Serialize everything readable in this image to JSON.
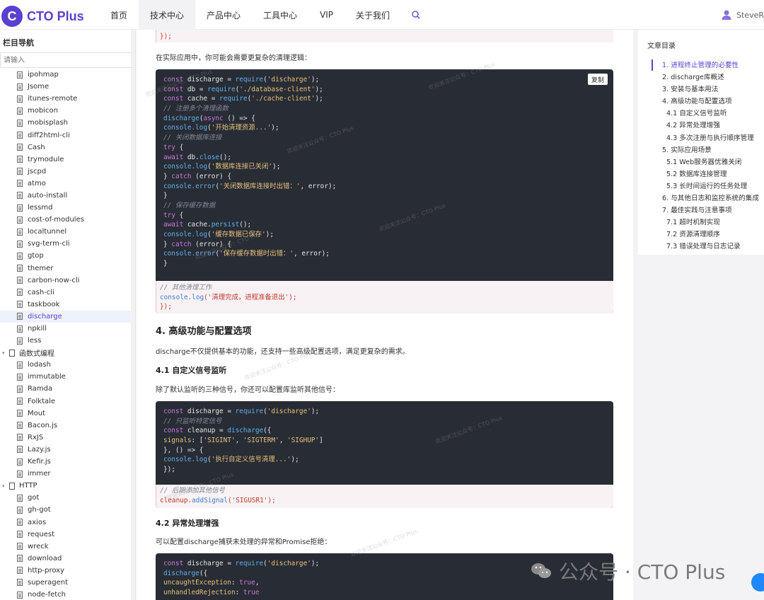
{
  "brand": {
    "logo_letter": "C",
    "name": "CTO Plus",
    "color": "#5b3fd0"
  },
  "nav": [
    {
      "label": "首页",
      "active": false
    },
    {
      "label": "技术中心",
      "active": true
    },
    {
      "label": "产品中心",
      "active": false
    },
    {
      "label": "工具中心",
      "active": false
    },
    {
      "label": "VIP",
      "active": false
    },
    {
      "label": "关于我们",
      "active": false
    }
  ],
  "user": {
    "name": "SteveR"
  },
  "sidebar": {
    "title": "栏目导航",
    "search_placeholder": "请输入",
    "items": [
      {
        "label": "ipohmap",
        "type": "child"
      },
      {
        "label": "Jsome",
        "type": "child"
      },
      {
        "label": "itunes-remote",
        "type": "child"
      },
      {
        "label": "mobicon",
        "type": "child"
      },
      {
        "label": "mobisplash",
        "type": "child"
      },
      {
        "label": "diff2html-cli",
        "type": "child"
      },
      {
        "label": "Cash",
        "type": "child"
      },
      {
        "label": "trymodule",
        "type": "child"
      },
      {
        "label": "jscpd",
        "type": "child"
      },
      {
        "label": "atmo",
        "type": "child"
      },
      {
        "label": "auto-install",
        "type": "child"
      },
      {
        "label": "lessmd",
        "type": "child"
      },
      {
        "label": "cost-of-modules",
        "type": "child"
      },
      {
        "label": "localtunnel",
        "type": "child"
      },
      {
        "label": "svg-term-cli",
        "type": "child"
      },
      {
        "label": "gtop",
        "type": "child"
      },
      {
        "label": "themer",
        "type": "child"
      },
      {
        "label": "carbon-now-cli",
        "type": "child"
      },
      {
        "label": "cash-cli",
        "type": "child"
      },
      {
        "label": "taskbook",
        "type": "child"
      },
      {
        "label": "discharge",
        "type": "child",
        "active": true
      },
      {
        "label": "npkill",
        "type": "child"
      },
      {
        "label": "less",
        "type": "child"
      },
      {
        "label": "函数式编程",
        "type": "group"
      },
      {
        "label": "lodash",
        "type": "child"
      },
      {
        "label": "immutable",
        "type": "child"
      },
      {
        "label": "Ramda",
        "type": "child"
      },
      {
        "label": "Folktale",
        "type": "child"
      },
      {
        "label": "Mout",
        "type": "child"
      },
      {
        "label": "Bacon.js",
        "type": "child"
      },
      {
        "label": "RxJS",
        "type": "child"
      },
      {
        "label": "Lazy.js",
        "type": "child"
      },
      {
        "label": "Kefir.js",
        "type": "child"
      },
      {
        "label": "immer",
        "type": "child"
      },
      {
        "label": "HTTP",
        "type": "group"
      },
      {
        "label": "got",
        "type": "child"
      },
      {
        "label": "gh-got",
        "type": "child"
      },
      {
        "label": "axios",
        "type": "child"
      },
      {
        "label": "request",
        "type": "child"
      },
      {
        "label": "wreck",
        "type": "child"
      },
      {
        "label": "download",
        "type": "child"
      },
      {
        "label": "http-proxy",
        "type": "child"
      },
      {
        "label": "superagent",
        "type": "child"
      },
      {
        "label": "node-fetch",
        "type": "child"
      }
    ]
  },
  "article": {
    "top_fragment": "});",
    "para_cleanup": "在实际应用中，你可能会需要更复杂的清理逻辑：",
    "copy_label": "复制",
    "h_section4": "4. 高级功能与配置选项",
    "para_section4": "discharge不仅提供基本的功能，还支持一些高级配置选项，满足更复杂的需求。",
    "h_41": "4.1 自定义信号监听",
    "para_41": "除了默认监听的三种信号，你还可以配置库监听其他信号：",
    "h_42": "4.2 异常处理增强",
    "para_42": "可以配置discharge捕获未处理的异常和Promise拒绝："
  },
  "toc": {
    "title": "文章目录",
    "items": [
      {
        "label": "1. 进程终止管理的必要性",
        "sub": false,
        "active": true
      },
      {
        "label": "2. discharge库概述",
        "sub": false
      },
      {
        "label": "3. 安装与基本用法",
        "sub": false
      },
      {
        "label": "4. 高级功能与配置选项",
        "sub": false
      },
      {
        "label": "4.1 自定义信号监听",
        "sub": true
      },
      {
        "label": "4.2 异常处理增强",
        "sub": true
      },
      {
        "label": "4.3 多次注册与执行顺序管理",
        "sub": true
      },
      {
        "label": "5. 实际应用场景",
        "sub": false
      },
      {
        "label": "5.1 Web服务器优雅关闭",
        "sub": true
      },
      {
        "label": "5.2 数据库连接管理",
        "sub": true
      },
      {
        "label": "5.3 长时间运行的任务处理",
        "sub": true
      },
      {
        "label": "6. 与其他日志和监控系统的集成",
        "sub": false
      },
      {
        "label": "7. 最佳实践与注意事项",
        "sub": false
      },
      {
        "label": "7.1 超时机制实现",
        "sub": true
      },
      {
        "label": "7.2 资源清理顺序",
        "sub": true
      },
      {
        "label": "7.3 错误处理与日志记录",
        "sub": true
      }
    ]
  },
  "footer_watermark": "公众号 · CTO Plus",
  "watermark_text": "欢迎关注公众号：CTO Plus"
}
